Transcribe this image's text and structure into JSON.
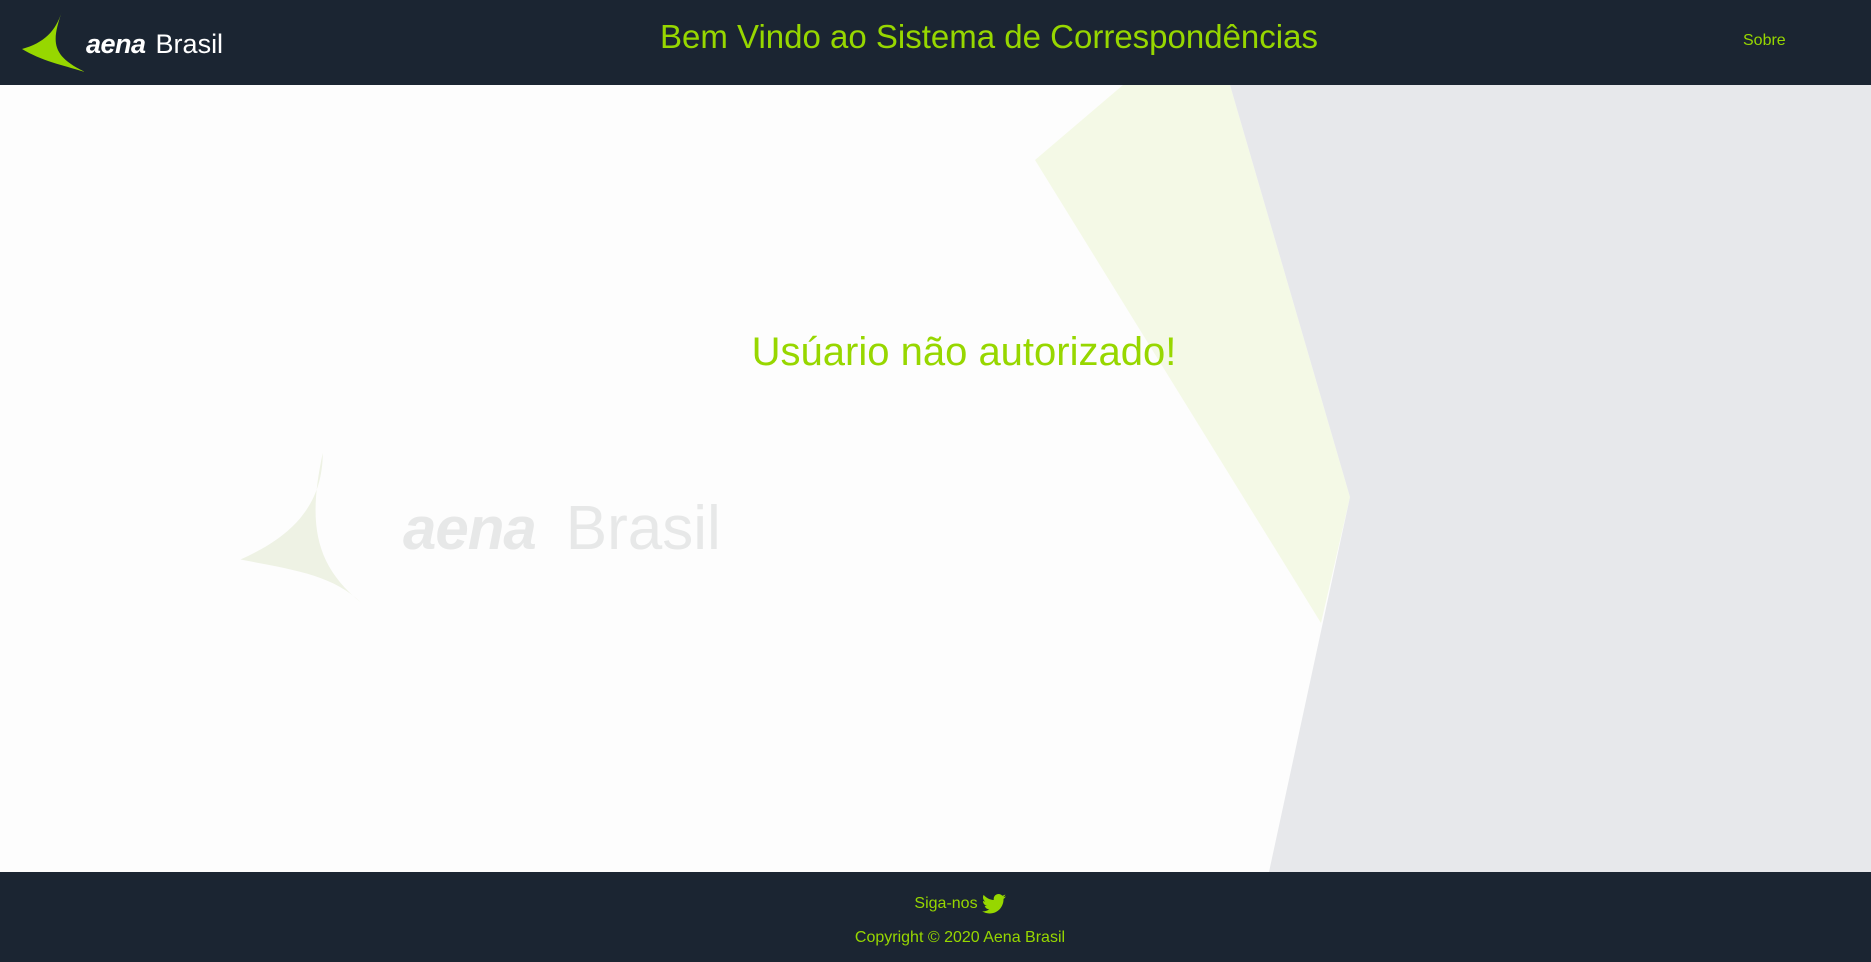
{
  "header": {
    "logo": {
      "brand": "aena",
      "region": "Brasil",
      "icon": "aena-arrow-logo-icon"
    },
    "title": "Bem Vindo ao Sistema de Correspondências",
    "nav": {
      "about_label": "Sobre"
    }
  },
  "main": {
    "message": "Usúario não autorizado!",
    "watermark": {
      "brand": "aena",
      "region": "Brasil"
    }
  },
  "footer": {
    "follow_label": "Siga-nos",
    "social_icon": "twitter-icon",
    "copyright": "Copyright © 2020 Aena Brasil"
  },
  "colors": {
    "accent": "#97d700",
    "header_bg": "#1b2532",
    "page_bg": "#fdfdfd",
    "panel_gray": "#e7e8eb",
    "panel_green": "#f4f9e6"
  }
}
